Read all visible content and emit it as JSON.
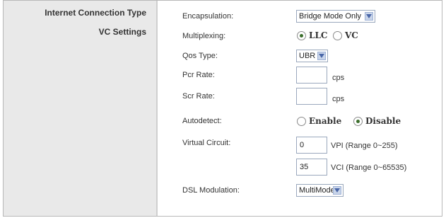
{
  "sections": {
    "internet_connection_type": "Internet Connection Type",
    "vc_settings": "VC Settings"
  },
  "fields": {
    "encapsulation": {
      "label": "Encapsulation:",
      "value": "Bridge Mode Only"
    },
    "multiplexing": {
      "label": "Multiplexing:",
      "options": [
        "LLC",
        "VC"
      ],
      "selected": "LLC"
    },
    "qos_type": {
      "label": "Qos Type:",
      "value": "UBR"
    },
    "pcr_rate": {
      "label": "Pcr Rate:",
      "value": "",
      "unit": "cps"
    },
    "scr_rate": {
      "label": "Scr Rate:",
      "value": "",
      "unit": "cps"
    },
    "autodetect": {
      "label": "Autodetect:",
      "options": [
        "Enable",
        "Disable"
      ],
      "selected": "Disable"
    },
    "virtual_circuit": {
      "label": "Virtual Circuit:",
      "vpi_value": "0",
      "vpi_range": "VPI (Range 0~255)",
      "vci_value": "35",
      "vci_range": "VCI (Range 0~65535)"
    },
    "dsl_modulation": {
      "label": "DSL Modulation:",
      "value": "MultiMode"
    }
  },
  "colors": {
    "left_panel": "#e9e9e9",
    "radio_selected": "#3b6e2b",
    "select_border": "#9aa8bd",
    "dropdown_arrow_bg": "#c9d5ea"
  }
}
